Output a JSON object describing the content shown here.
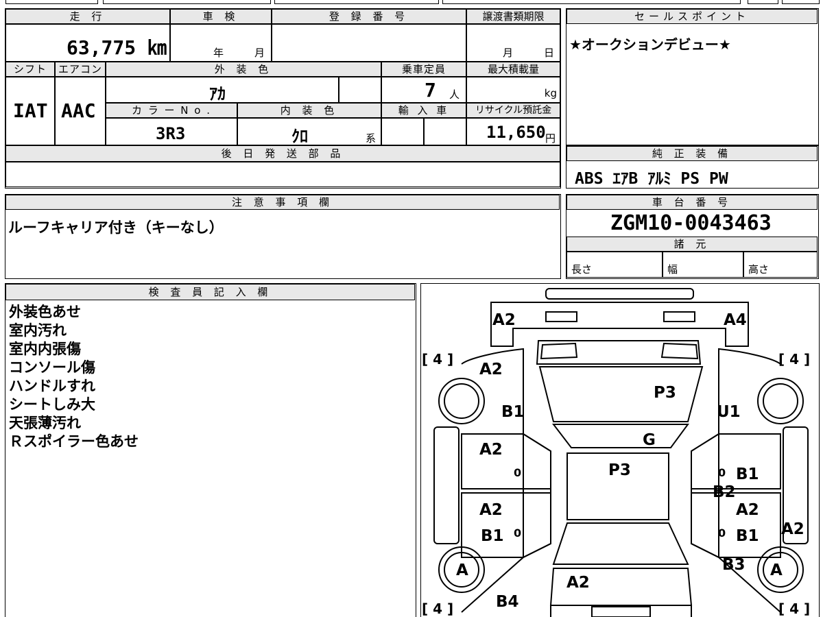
{
  "specs": {
    "mileage_label": "走 行",
    "mileage_value": "63,775 ㎞",
    "inspection_label": "車 検",
    "inspection_year": "年",
    "inspection_month": "月",
    "registration_label": "登 録 番 号",
    "transfer_label": "譲渡書類期限",
    "transfer_month": "月",
    "transfer_day": "日",
    "shift_label": "シフト",
    "shift_value": "IAT",
    "ac_label": "エアコン",
    "ac_value": "AAC",
    "exterior_label": "外 装 色",
    "exterior_value": "ｱｶ",
    "color_no_label": "カ ラ ー N o .",
    "color_no_value": "3R3",
    "interior_label": "内 装 色",
    "interior_value": "ｸﾛ",
    "interior_suffix": "系",
    "capacity_label": "乗車定員",
    "capacity_value": "7",
    "capacity_unit": "人",
    "maxload_label": "最大積載量",
    "maxload_unit": "kg",
    "import_label": "輸 入 車",
    "recycle_label": "リサイクル預託金",
    "recycle_value": "11,650",
    "recycle_unit": "円",
    "later_parts_label": "後 日 発 送 部 品"
  },
  "sales": {
    "label": "セールスポイント",
    "text": "★オークションデビュー★"
  },
  "equipment": {
    "label": "純 正 装 備",
    "text": "ABS ｴｱB ｱﾙﾐ PS PW"
  },
  "notes": {
    "label": "注 意 事 項 欄",
    "text": "ルーフキャリア付き（キーなし）"
  },
  "chassis": {
    "label": "車 台 番 号",
    "value": "ZGM10-0043463",
    "dims_label": "諸 元",
    "length_label": "長さ",
    "width_label": "幅",
    "height_label": "高さ"
  },
  "inspector": {
    "label": "検 査 員 記 入 欄",
    "lines": [
      "外装色あせ",
      "室内汚れ",
      "室内内張傷",
      "コンソール傷",
      "ハンドルすれ",
      "シートしみ大",
      "天張薄汚れ",
      "Ｒスポイラー色あせ"
    ]
  },
  "diagram": {
    "marks": [
      "A2",
      "A4",
      "A2",
      "P3",
      "B1",
      "U1",
      "G",
      "A2",
      "P3",
      "B1",
      "B2",
      "A2",
      "A2",
      "B1",
      "B1",
      "A2",
      "A",
      "B3",
      "A",
      "A2",
      "B4"
    ],
    "tires": [
      "[ 4 ]",
      "[ 4 ]",
      "[ 4 ]",
      "[ 4 ]"
    ],
    "zeros": [
      "0",
      "0",
      "0",
      "0"
    ]
  }
}
